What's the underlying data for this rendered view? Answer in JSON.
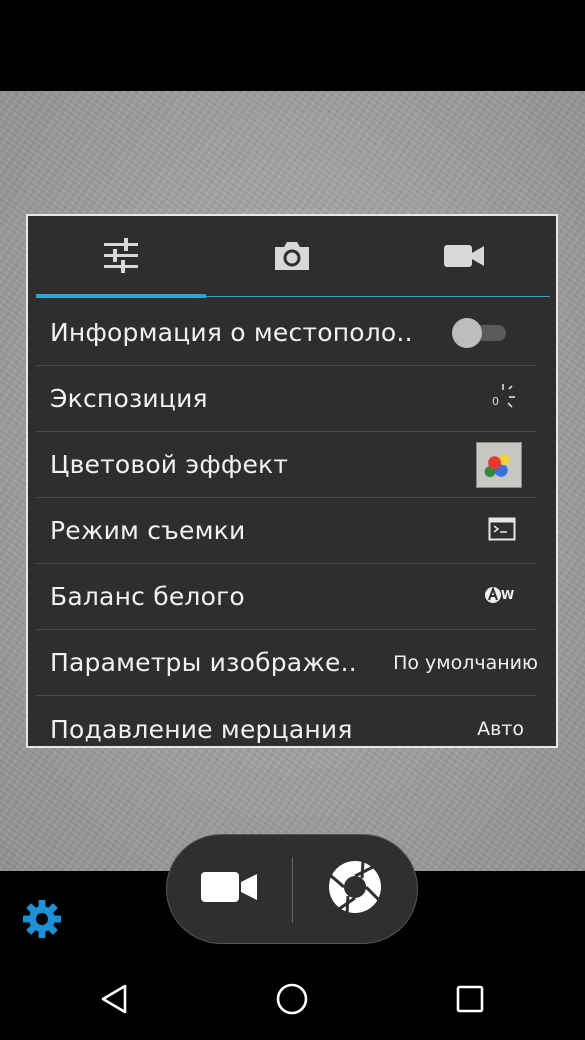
{
  "tabs": [
    {
      "icon": "sliders-icon",
      "active": true
    },
    {
      "icon": "camera-icon",
      "active": false
    },
    {
      "icon": "video-camera-icon",
      "active": false
    }
  ],
  "settings": [
    {
      "label": "Информация о местополо..",
      "control": "toggle",
      "toggle_on": false
    },
    {
      "label": "Экспозиция",
      "control": "icon",
      "icon": "exposure-icon",
      "icon_text": "0"
    },
    {
      "label": "Цветовой эффект",
      "control": "thumbnail",
      "icon": "color-effect-thumbnail"
    },
    {
      "label": "Режим съемки",
      "control": "icon",
      "icon": "scene-mode-icon"
    },
    {
      "label": "Баланс белого",
      "control": "icon",
      "icon": "white-balance-auto-icon",
      "icon_text": "W"
    },
    {
      "label": "Параметры изображе..",
      "control": "value",
      "value": "По умолчанию"
    },
    {
      "label": "Подавление мерцания",
      "control": "value",
      "value": "Авто"
    }
  ],
  "controls": {
    "video_icon": "video-camera-icon",
    "shutter_icon": "shutter-icon",
    "settings_icon": "gear-icon"
  },
  "navbar": {
    "back_icon": "back-icon",
    "home_icon": "home-icon",
    "recents_icon": "recents-icon"
  },
  "colors": {
    "accent": "#2aa7d8",
    "panel_bg": "#2e2e2d",
    "gear": "#1e90d6"
  }
}
